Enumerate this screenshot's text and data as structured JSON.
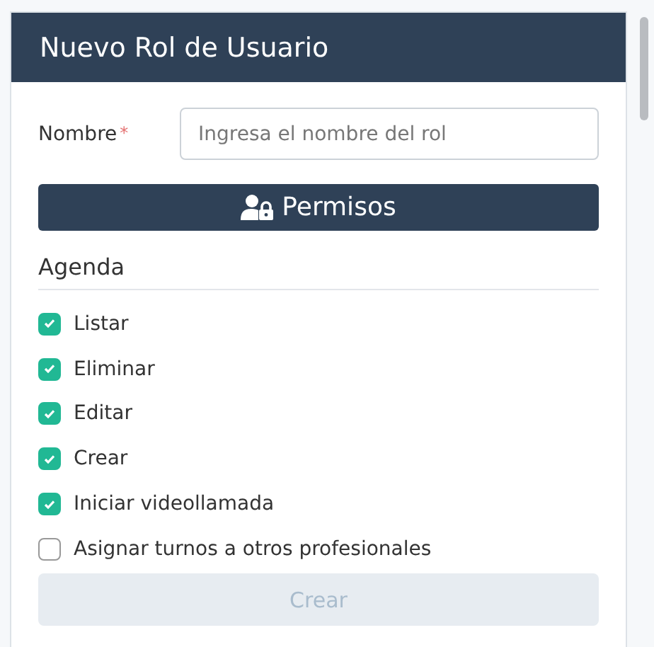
{
  "window": {
    "title": "Nuevo Rol de Usuario"
  },
  "name_field": {
    "label": "Nombre",
    "required_mark": "*",
    "placeholder": "Ingresa el nombre del rol"
  },
  "permissions_button": {
    "label": "Permisos"
  },
  "section": {
    "title": "Agenda"
  },
  "permissions": [
    {
      "label": "Listar",
      "checked": true
    },
    {
      "label": "Eliminar",
      "checked": true
    },
    {
      "label": "Editar",
      "checked": true
    },
    {
      "label": "Crear",
      "checked": true
    },
    {
      "label": "Iniciar videollamada",
      "checked": true
    },
    {
      "label": "Asignar turnos a otros profesionales",
      "checked": false
    }
  ],
  "submit_button": {
    "label": "Crear",
    "disabled": true
  }
}
